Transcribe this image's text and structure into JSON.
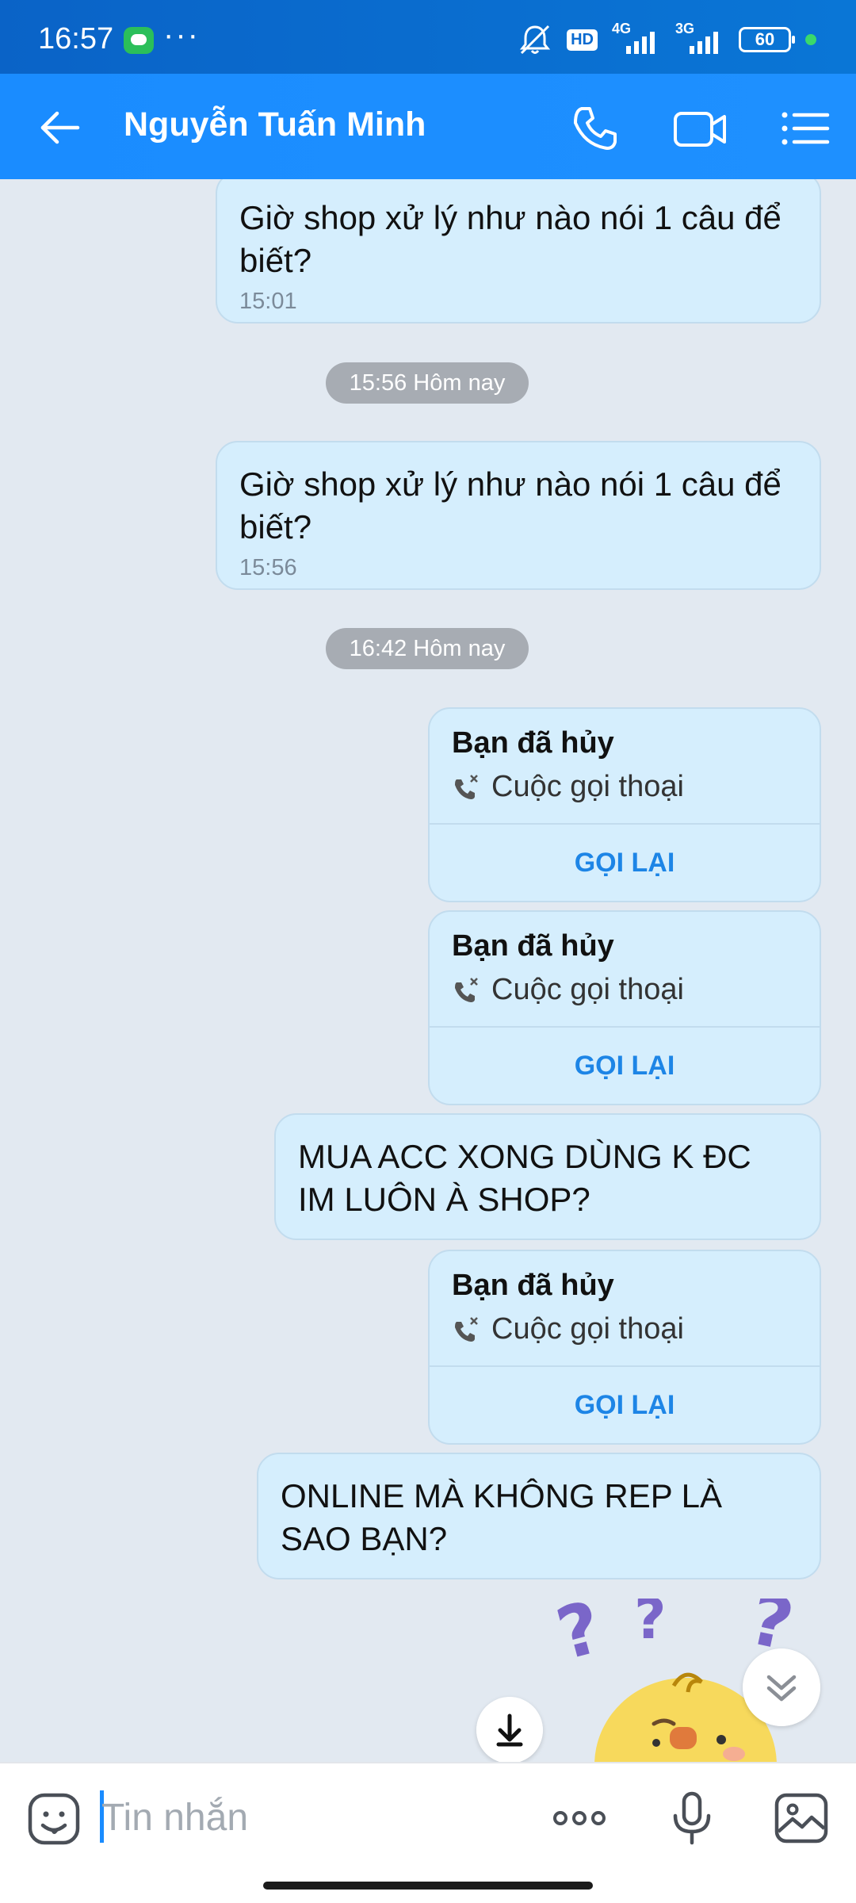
{
  "status_bar": {
    "time": "16:57",
    "dots": "···",
    "hd": "HD",
    "net1": "4G",
    "net2": "3G",
    "battery": "60",
    "bg_color": "#0a6ad0"
  },
  "header": {
    "title": "Nguyễn Tuấn Minh",
    "bg_color": "#1a8cff"
  },
  "messages": [
    {
      "text": "Giờ shop xử lý như nào nói 1 câu để biết?",
      "time": "15:01"
    },
    {
      "text": "Giờ shop xử lý như nào nói 1 câu để biết?",
      "time": "15:56"
    }
  ],
  "time_separators": [
    "15:56 Hôm nay",
    "16:42 Hôm nay"
  ],
  "call_cards": [
    {
      "title": "Bạn đã hủy",
      "subtitle": "Cuộc gọi thoại",
      "action": "GỌI LẠI"
    },
    {
      "title": "Bạn đã hủy",
      "subtitle": "Cuộc gọi thoại",
      "action": "GỌI LẠI"
    },
    {
      "title": "Bạn đã hủy",
      "subtitle": "Cuộc gọi thoại",
      "action": "GỌI LẠI"
    }
  ],
  "text_messages": [
    "MUA ACC XONG DÙNG K ĐC IM LUÔN À SHOP?",
    "ONLINE MÀ KHÔNG REP LÀ SAO BẠN?"
  ],
  "input": {
    "placeholder": "Tin nhắn",
    "value": ""
  },
  "colors": {
    "bubble": "#d5eefd",
    "accent": "#1d85e6",
    "chat_bg": "#e2e9f1"
  }
}
